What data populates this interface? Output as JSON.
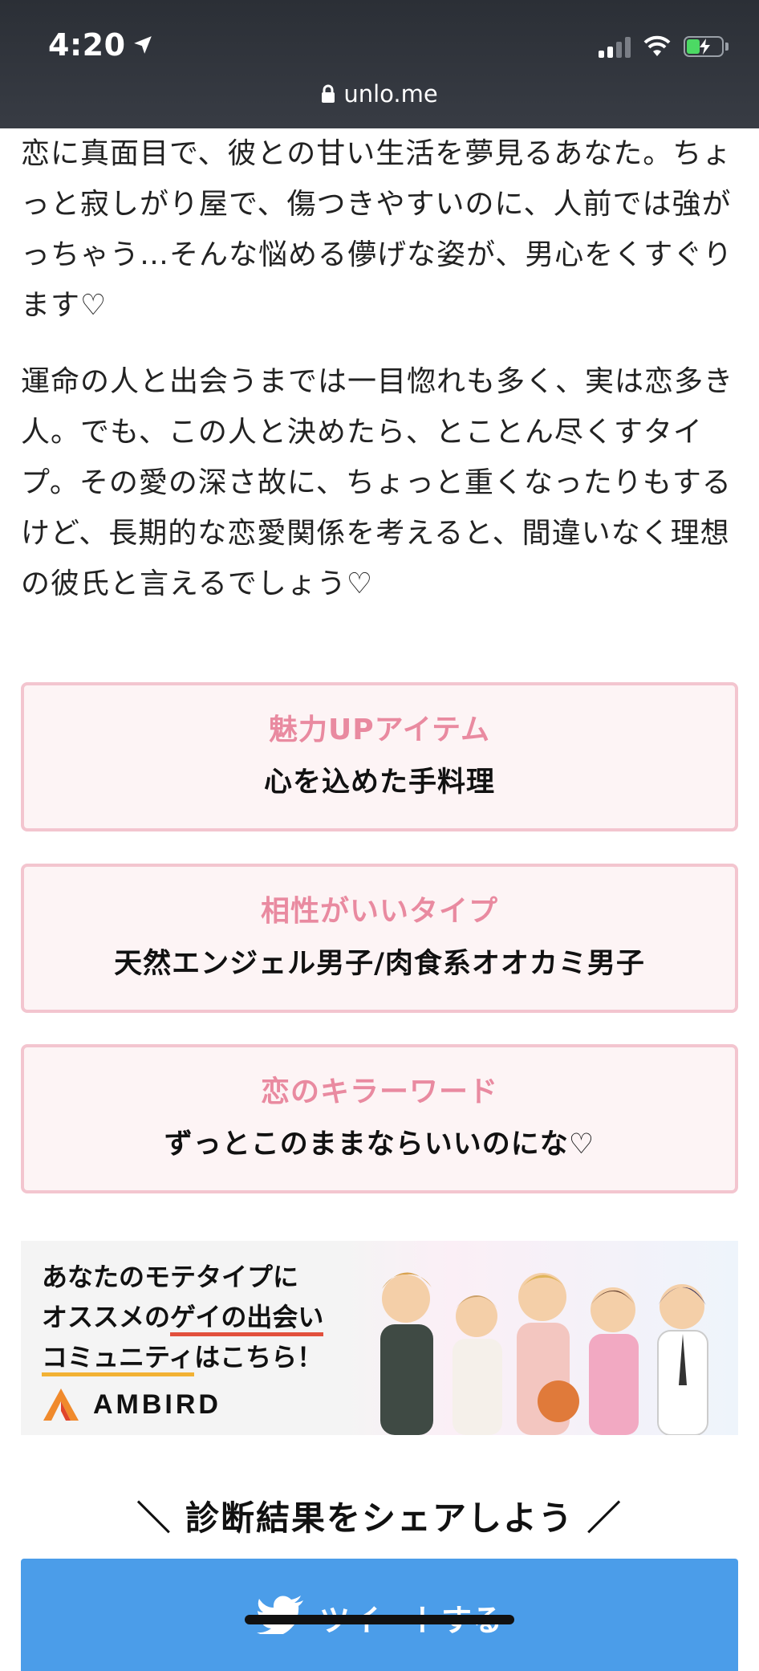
{
  "status_bar": {
    "time": "4:20",
    "url": "unlo.me"
  },
  "article": {
    "paragraph_1": "恋に真面目で、彼との甘い生活を夢見るあなた。ちょっと寂しがり屋で、傷つきやすいのに、人前では強がっちゃう…そんな悩める儚げな姿が、男心をくすぐります♡",
    "paragraph_2": "運命の人と出会うまでは一目惚れも多く、実は恋多き人。でも、この人と決めたら、とことん尽くすタイプ。その愛の深さ故に、ちょっと重くなったりもするけど、長期的な恋愛関係を考えると、間違いなく理想の彼氏と言えるでしょう♡"
  },
  "boxes": [
    {
      "label": "魅力UPアイテム",
      "value": "心を込めた手料理"
    },
    {
      "label": "相性がいいタイプ",
      "value": "天然エンジェル男子/肉食系オオカミ男子"
    },
    {
      "label": "恋のキラーワード",
      "value": "ずっとこのままならいいのにな♡"
    }
  ],
  "banner": {
    "line1": "あなたのモテタイプに",
    "line2a": "オススメの",
    "line2b": "ゲイの出会い",
    "line3a": "コミュニティ",
    "line3b": "はこちら！",
    "brand": "AMBIRD"
  },
  "share": {
    "title": "＼ 診断結果をシェアしよう ／",
    "tweet_label": "ツイートする"
  }
}
